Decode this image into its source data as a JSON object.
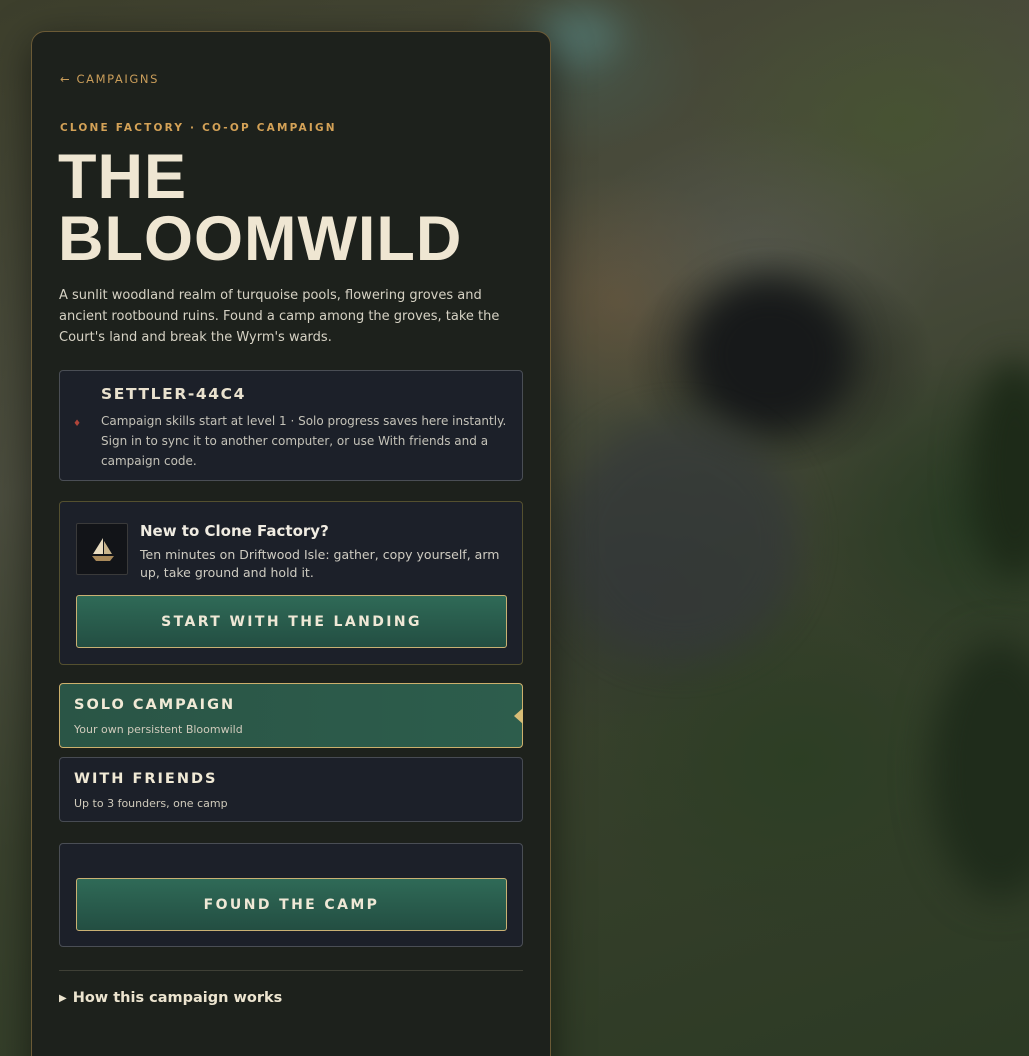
{
  "nav": {
    "back_label": "← CAMPAIGNS"
  },
  "campaign": {
    "eyebrow": "CLONE FACTORY · CO-OP CAMPAIGN",
    "title": "THE BLOOMWILD",
    "description": "A sunlit woodland realm of turquoise pools, flowering groves and ancient rootbound ruins. Found a camp among the groves, take the Court's land and break the Wyrm's wards."
  },
  "settler": {
    "name": "SETTLER-44C4",
    "info": "Campaign skills start at level 1 · Solo progress saves here instantly. Sign in to sync it to another computer, or use With friends and a campaign code."
  },
  "tutorial": {
    "icon": "sailboat-icon",
    "title": "New to Clone Factory?",
    "text": "Ten minutes on Driftwood Isle: gather, copy yourself, arm up, take ground and hold it.",
    "button_label": "START WITH THE LANDING"
  },
  "modes": {
    "solo": {
      "title": "SOLO CAMPAIGN",
      "subtitle": "Your own persistent Bloomwild",
      "selected": true
    },
    "friends": {
      "title": "WITH FRIENDS",
      "subtitle": "Up to 3 founders, one camp",
      "selected": false
    }
  },
  "actions": {
    "found_label": "FOUND THE CAMP"
  },
  "details": {
    "label": "How this campaign works"
  },
  "colors": {
    "accent_gold": "#d4a257",
    "button_green": "#2f6a57",
    "panel_bg": "#1d211c",
    "card_bg": "#1c2029"
  }
}
